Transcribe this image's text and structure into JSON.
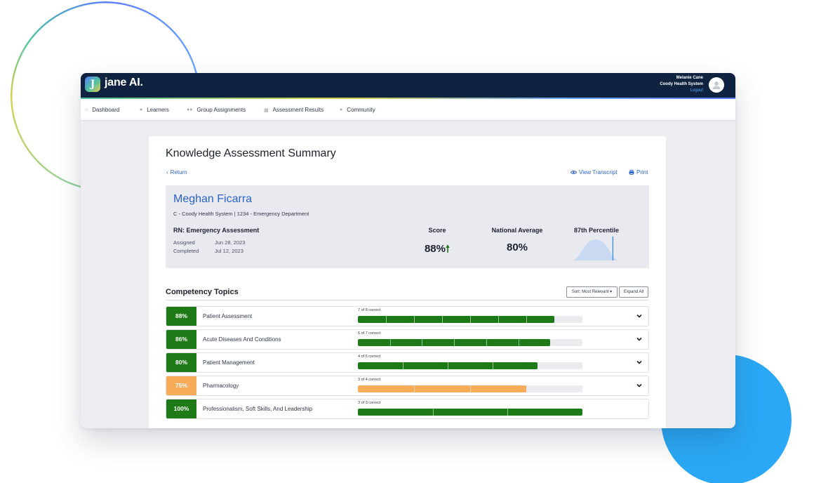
{
  "app": {
    "logo_text": "jane AI.",
    "logo_mark": "J"
  },
  "user": {
    "name": "Melanie Cane",
    "org": "Coody Health System",
    "logout": "Logout"
  },
  "nav": {
    "items": [
      {
        "label": "Dashboard",
        "icon": "house-icon"
      },
      {
        "label": "Learners",
        "icon": "person-icon"
      },
      {
        "label": "Group Assignments",
        "icon": "group-icon"
      },
      {
        "label": "Assessment Results",
        "icon": "chart-icon"
      },
      {
        "label": "Community",
        "icon": "chat-icon"
      }
    ]
  },
  "page": {
    "title": "Knowledge Assessment Summary",
    "return_label": "Return",
    "view_transcript_label": "View Transcript",
    "print_label": "Print"
  },
  "summary": {
    "learner_name": "Meghan Ficarra",
    "learner_org": "C - Coody Health System | 1234 - Emergency Department",
    "assessment_title": "RN: Emergency Assessment",
    "assigned_label": "Assigned",
    "assigned_date": "Jun 28, 2023",
    "completed_label": "Completed",
    "completed_date": "Jul 12, 2023",
    "score_label": "Score",
    "score_value": "88%",
    "national_label": "National Average",
    "national_value": "80%",
    "percentile_label": "87th Percentile",
    "percentile": 87
  },
  "competency": {
    "title": "Competency Topics",
    "sort_label": "Sort: Most Relevant",
    "expand_label": "Expand All",
    "topics": [
      {
        "score": "88%",
        "name": "Patient Assessment",
        "correct_text": "7 of 8 correct",
        "correct": 7,
        "total": 8,
        "status": "pass"
      },
      {
        "score": "86%",
        "name": "Acute Diseases And Conditions",
        "correct_text": "6 of 7 correct",
        "correct": 6,
        "total": 7,
        "status": "pass"
      },
      {
        "score": "80%",
        "name": "Patient Management",
        "correct_text": "4 of 5 correct",
        "correct": 4,
        "total": 5,
        "status": "pass"
      },
      {
        "score": "75%",
        "name": "Pharmacology",
        "correct_text": "3 of 4 correct",
        "correct": 3,
        "total": 4,
        "status": "warn"
      },
      {
        "score": "100%",
        "name": "Professionalism, Soft Skills, And Leadership",
        "correct_text": "3 of 3 correct",
        "correct": 3,
        "total": 3,
        "status": "pass"
      }
    ]
  },
  "colors": {
    "pass": "#1d7a16",
    "warn": "#f7ac5a",
    "accent": "#2b62c9",
    "header": "#0f2340"
  }
}
